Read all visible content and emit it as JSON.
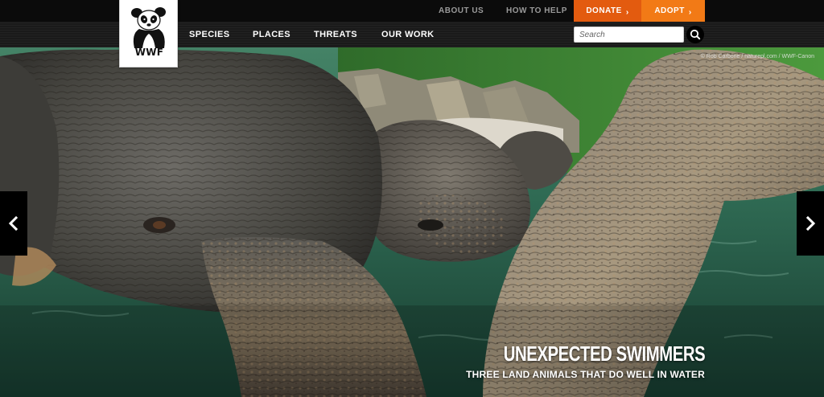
{
  "top_links": {
    "about": "ABOUT US",
    "help": "HOW TO HELP"
  },
  "cta": {
    "donate": "DONATE",
    "adopt": "ADOPT",
    "chevron": "›"
  },
  "brand": {
    "logo_text": "WWF",
    "logo_icon": "panda-icon"
  },
  "nav": {
    "items": [
      "SPECIES",
      "PLACES",
      "THREATS",
      "OUR WORK"
    ]
  },
  "search": {
    "placeholder": "Search",
    "icon": "search-icon"
  },
  "hero": {
    "photo_credit": "© Rob Carbone / naturepl.com / WWF-Canon",
    "title": "UNEXPECTED SWIMMERS",
    "subtitle": "THREE LAND ANIMALS THAT DO WELL IN WATER"
  },
  "carousel": {
    "prev_icon": "chevron-left-icon",
    "next_icon": "chevron-right-icon"
  },
  "colors": {
    "donate": "#e35b0f",
    "adopt": "#f27a16",
    "topbar": "#0b0b0b",
    "navbar": "#1a1a1a"
  }
}
